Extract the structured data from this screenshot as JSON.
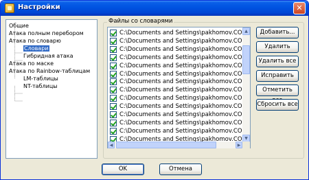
{
  "window": {
    "title": "Настройки",
    "close_label": "✕"
  },
  "tree": {
    "items": [
      {
        "label": "Общие",
        "indent": 0,
        "selected": false
      },
      {
        "label": "Атака полным перебором",
        "indent": 0,
        "selected": false
      },
      {
        "label": "Атака по словарю",
        "indent": 0,
        "selected": false
      },
      {
        "label": "Словари",
        "indent": 1,
        "selected": true
      },
      {
        "label": "Гибридная атака",
        "indent": 1,
        "selected": false
      },
      {
        "label": "Атака по маске",
        "indent": 0,
        "selected": false
      },
      {
        "label": "Атака по Rainbow-таблицам",
        "indent": 0,
        "selected": false
      },
      {
        "label": "LM-таблицы",
        "indent": 1,
        "selected": false
      },
      {
        "label": "NT-таблицы",
        "indent": 1,
        "selected": false
      }
    ]
  },
  "dictionaries": {
    "group_title": "Файлы со словарями",
    "files": [
      {
        "path": "C:\\Documents and Settings\\pakhomov.COMPL",
        "checked": true
      },
      {
        "path": "C:\\Documents and Settings\\pakhomov.COMPL",
        "checked": true
      },
      {
        "path": "C:\\Documents and Settings\\pakhomov.COMPL",
        "checked": true
      },
      {
        "path": "C:\\Documents and Settings\\pakhomov.COMPL",
        "checked": true
      },
      {
        "path": "C:\\Documents and Settings\\pakhomov.COMPL",
        "checked": true
      },
      {
        "path": "C:\\Documents and Settings\\pakhomov.COMPL",
        "checked": true
      },
      {
        "path": "C:\\Documents and Settings\\pakhomov.COMPL",
        "checked": true
      },
      {
        "path": "C:\\Documents and Settings\\pakhomov.COMPL",
        "checked": true
      },
      {
        "path": "C:\\Documents and Settings\\pakhomov.COMPL",
        "checked": true
      },
      {
        "path": "C:\\Documents and Settings\\pakhomov.COMPL",
        "checked": true
      },
      {
        "path": "C:\\Documents and Settings\\pakhomov.COMPL",
        "checked": true
      },
      {
        "path": "C:\\Documents and Settings\\pakhomov.COMPL",
        "checked": true
      },
      {
        "path": "C:\\Documents and Settings\\pakhomov.COMPL",
        "checked": true
      },
      {
        "path": "C:\\Documents and Settings\\pakhomov.COMPL",
        "checked": true
      }
    ],
    "buttons": {
      "add": "Добавить...",
      "remove": "Удалить",
      "remove_all": "Удалить все",
      "fix": "Исправить",
      "check_all": "Отметить все",
      "reset_all": "Сбросить все"
    }
  },
  "footer": {
    "ok": "OK",
    "cancel": "Отмена"
  },
  "colors": {
    "titlebar": "#0053e1",
    "selection": "#316ac5",
    "checkmark": "#21a121",
    "dialog_bg": "#ece9d8"
  },
  "icons": {
    "title_icon": "app-key-icon",
    "close": "close-icon",
    "scroll_up": "arrow-up-icon",
    "scroll_down": "arrow-down-icon",
    "scroll_left": "arrow-left-icon",
    "scroll_right": "arrow-right-icon"
  }
}
